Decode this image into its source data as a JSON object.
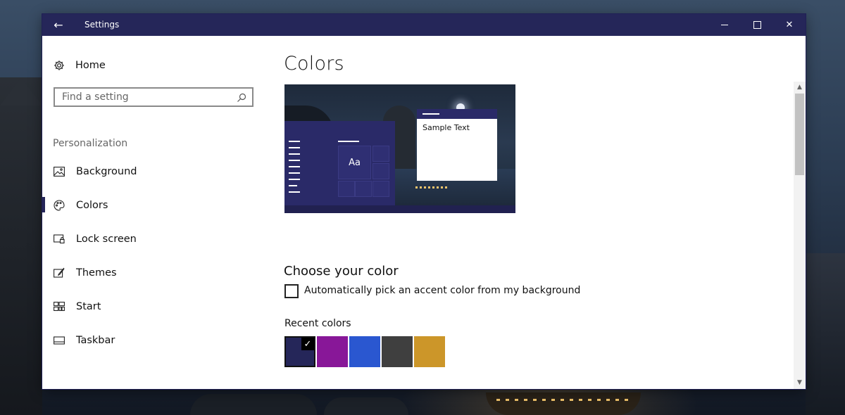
{
  "window": {
    "title": "Settings",
    "back_glyph": "←",
    "close_glyph": "✕",
    "titlebar_color": "#252659"
  },
  "sidebar": {
    "home": {
      "label": "Home",
      "icon": "gear-icon"
    },
    "search": {
      "placeholder": "Find a setting",
      "icon": "search-icon"
    },
    "section": "Personalization",
    "items": [
      {
        "label": "Background",
        "icon": "image-icon",
        "selected": false
      },
      {
        "label": "Colors",
        "icon": "palette-icon",
        "selected": true
      },
      {
        "label": "Lock screen",
        "icon": "lock-screen-icon",
        "selected": false
      },
      {
        "label": "Themes",
        "icon": "themes-brush-icon",
        "selected": false
      },
      {
        "label": "Start",
        "icon": "start-tiles-icon",
        "selected": false
      },
      {
        "label": "Taskbar",
        "icon": "taskbar-icon",
        "selected": false
      }
    ]
  },
  "main": {
    "title": "Colors",
    "preview": {
      "tile_text": "Aa",
      "sample_text": "Sample Text"
    },
    "choose_heading": "Choose your color",
    "auto_pick": {
      "label": "Automatically pick an accent color from my background",
      "checked": false
    },
    "recent_label": "Recent colors",
    "recent_colors": [
      {
        "color": "#252659",
        "selected": true
      },
      {
        "color": "#881798",
        "selected": false
      },
      {
        "color": "#2a57d0",
        "selected": false
      },
      {
        "color": "#3f3f3f",
        "selected": false
      },
      {
        "color": "#cc9629",
        "selected": false
      }
    ],
    "check_glyph": "✓"
  }
}
